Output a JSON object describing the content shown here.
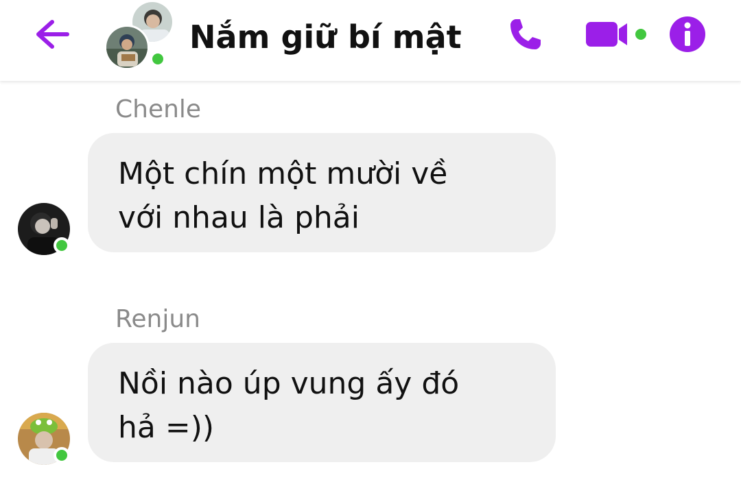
{
  "header": {
    "title": "Nắm giữ bí mật",
    "back_icon": "arrow-left-icon",
    "call_icon": "phone-icon",
    "video_icon": "video-camera-icon",
    "info_icon": "info-icon",
    "accent_color": "#9b1fe8",
    "online_color": "#42c73f"
  },
  "messages": [
    {
      "sender": "Chenle",
      "lines": [
        "Một chín một mười về",
        "với nhau là phải"
      ]
    },
    {
      "sender": "Renjun",
      "lines": [
        "Nồi nào úp vung ấy đó",
        "hả =))"
      ]
    }
  ]
}
